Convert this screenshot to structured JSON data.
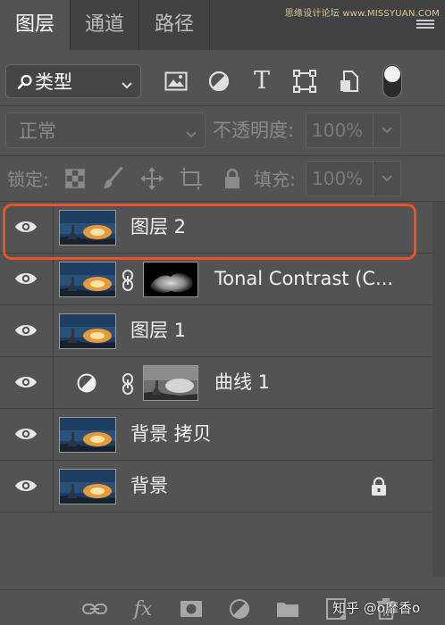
{
  "watermark": "思缘设计论坛 www.MISSYUAN.COM",
  "tabs": [
    {
      "label": "图层",
      "active": true
    },
    {
      "label": "通道",
      "active": false
    },
    {
      "label": "路径",
      "active": false
    }
  ],
  "filter": {
    "label": "类型",
    "icons": [
      "image-filter-icon",
      "adjustment-filter-icon",
      "type-filter-icon",
      "shape-filter-icon",
      "smart-object-filter-icon"
    ],
    "type_glyph": "T"
  },
  "blend": {
    "mode": "正常",
    "opacity_label": "不透明度:",
    "opacity_value": "100%"
  },
  "lock": {
    "label": "锁定:",
    "fill_label": "填充:",
    "fill_value": "100%"
  },
  "layers": [
    {
      "name": "图层 2",
      "visible": true,
      "selected": true,
      "has_mask": false,
      "adjustment": false,
      "locked": false
    },
    {
      "name": "Tonal Contrast (C...",
      "visible": true,
      "selected": false,
      "has_mask": true,
      "adjustment": false,
      "locked": false
    },
    {
      "name": "图层 1",
      "visible": true,
      "selected": false,
      "has_mask": false,
      "adjustment": false,
      "locked": false
    },
    {
      "name": "曲线 1",
      "visible": true,
      "selected": false,
      "has_mask": true,
      "adjustment": true,
      "locked": false
    },
    {
      "name": "背景 拷贝",
      "visible": true,
      "selected": false,
      "has_mask": false,
      "adjustment": false,
      "locked": false
    },
    {
      "name": "背景",
      "visible": true,
      "selected": false,
      "has_mask": false,
      "adjustment": false,
      "locked": true
    }
  ],
  "bottom": {
    "fx_label": "fx",
    "credit": "知乎 @o靡香o",
    "icons": [
      "link-layers-icon",
      "fx-icon",
      "add-mask-icon",
      "new-adjustment-icon",
      "new-group-icon",
      "new-layer-icon",
      "trash-icon"
    ]
  },
  "colors": {
    "highlight": "#e8532b",
    "panel": "#535353",
    "tabbar": "#424242"
  }
}
